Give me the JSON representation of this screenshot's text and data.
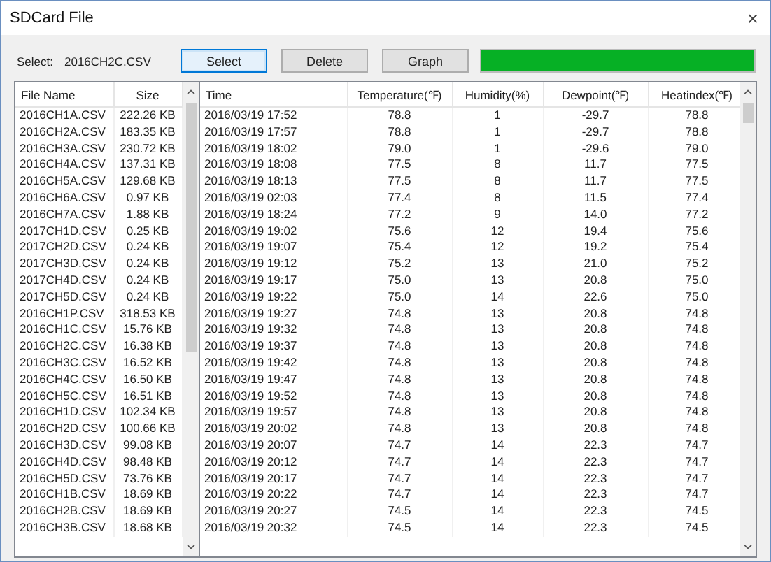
{
  "window": {
    "title": "SDCard File",
    "close": "×"
  },
  "toolbar": {
    "label": "Select:",
    "file": "2016CH2C.CSV",
    "buttons": [
      {
        "label": "Select",
        "focused": true
      },
      {
        "label": "Delete",
        "focused": false
      },
      {
        "label": "Graph",
        "focused": false
      }
    ],
    "progress": {
      "level": 1
    }
  },
  "files": {
    "columns": [
      "File Name",
      "Size"
    ],
    "rows": [
      [
        "2016CH1A.CSV",
        "222.26 KB"
      ],
      [
        "2016CH2A.CSV",
        "183.35 KB"
      ],
      [
        "2016CH3A.CSV",
        "230.72 KB"
      ],
      [
        "2016CH4A.CSV",
        "137.31 KB"
      ],
      [
        "2016CH5A.CSV",
        "129.68 KB"
      ],
      [
        "2016CH6A.CSV",
        "0.97 KB"
      ],
      [
        "2016CH7A.CSV",
        "1.88 KB"
      ],
      [
        "2017CH1D.CSV",
        "0.25 KB"
      ],
      [
        "2017CH2D.CSV",
        "0.24 KB"
      ],
      [
        "2017CH3D.CSV",
        "0.24 KB"
      ],
      [
        "2017CH4D.CSV",
        "0.24 KB"
      ],
      [
        "2017CH5D.CSV",
        "0.24 KB"
      ],
      [
        "2016CH1P.CSV",
        "318.53 KB"
      ],
      [
        "2016CH1C.CSV",
        "15.76 KB"
      ],
      [
        "2016CH2C.CSV",
        "16.38 KB"
      ],
      [
        "2016CH3C.CSV",
        "16.52 KB"
      ],
      [
        "2016CH4C.CSV",
        "16.50 KB"
      ],
      [
        "2016CH5C.CSV",
        "16.51 KB"
      ],
      [
        "2016CH1D.CSV",
        "102.34 KB"
      ],
      [
        "2016CH2D.CSV",
        "100.66 KB"
      ],
      [
        "2016CH3D.CSV",
        "99.08 KB"
      ],
      [
        "2016CH4D.CSV",
        "98.48 KB"
      ],
      [
        "2016CH5D.CSV",
        "73.76 KB"
      ],
      [
        "2016CH1B.CSV",
        "18.69 KB"
      ],
      [
        "2016CH2B.CSV",
        "18.69 KB"
      ],
      [
        "2016CH3B.CSV",
        "18.68 KB"
      ]
    ]
  },
  "records": {
    "columns": [
      "Time",
      "Temperature(℉)",
      "Humidity(%)",
      "Dewpoint(℉)",
      "Heatindex(℉)"
    ],
    "rows": [
      [
        "2016/03/19 17:52",
        "78.8",
        "1",
        "-29.7",
        "78.8"
      ],
      [
        "2016/03/19 17:57",
        "78.8",
        "1",
        "-29.7",
        "78.8"
      ],
      [
        "2016/03/19 18:02",
        "79.0",
        "1",
        "-29.6",
        "79.0"
      ],
      [
        "2016/03/19 18:08",
        "77.5",
        "8",
        "11.7",
        "77.5"
      ],
      [
        "2016/03/19 18:13",
        "77.5",
        "8",
        "11.7",
        "77.5"
      ],
      [
        "2016/03/19 02:03",
        "77.4",
        "8",
        "11.5",
        "77.4"
      ],
      [
        "2016/03/19 18:24",
        "77.2",
        "9",
        "14.0",
        "77.2"
      ],
      [
        "2016/03/19 19:02",
        "75.6",
        "12",
        "19.4",
        "75.6"
      ],
      [
        "2016/03/19 19:07",
        "75.4",
        "12",
        "19.2",
        "75.4"
      ],
      [
        "2016/03/19 19:12",
        "75.2",
        "13",
        "21.0",
        "75.2"
      ],
      [
        "2016/03/19 19:17",
        "75.0",
        "13",
        "20.8",
        "75.0"
      ],
      [
        "2016/03/19 19:22",
        "75.0",
        "14",
        "22.6",
        "75.0"
      ],
      [
        "2016/03/19 19:27",
        "74.8",
        "13",
        "20.8",
        "74.8"
      ],
      [
        "2016/03/19 19:32",
        "74.8",
        "13",
        "20.8",
        "74.8"
      ],
      [
        "2016/03/19 19:37",
        "74.8",
        "13",
        "20.8",
        "74.8"
      ],
      [
        "2016/03/19 19:42",
        "74.8",
        "13",
        "20.8",
        "74.8"
      ],
      [
        "2016/03/19 19:47",
        "74.8",
        "13",
        "20.8",
        "74.8"
      ],
      [
        "2016/03/19 19:52",
        "74.8",
        "13",
        "20.8",
        "74.8"
      ],
      [
        "2016/03/19 19:57",
        "74.8",
        "13",
        "20.8",
        "74.8"
      ],
      [
        "2016/03/19 20:02",
        "74.8",
        "13",
        "20.8",
        "74.8"
      ],
      [
        "2016/03/19 20:07",
        "74.7",
        "14",
        "22.3",
        "74.7"
      ],
      [
        "2016/03/19 20:12",
        "74.7",
        "14",
        "22.3",
        "74.7"
      ],
      [
        "2016/03/19 20:17",
        "74.7",
        "14",
        "22.3",
        "74.7"
      ],
      [
        "2016/03/19 20:22",
        "74.7",
        "14",
        "22.3",
        "74.7"
      ],
      [
        "2016/03/19 20:27",
        "74.5",
        "14",
        "22.3",
        "74.5"
      ],
      [
        "2016/03/19 20:32",
        "74.5",
        "14",
        "22.3",
        "74.5"
      ]
    ]
  }
}
